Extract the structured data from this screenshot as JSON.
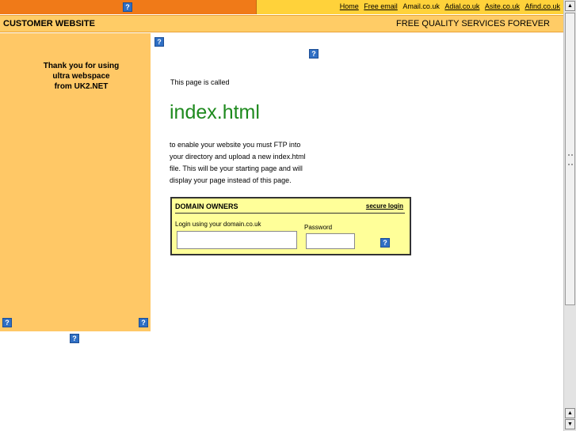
{
  "top_links": [
    "Home",
    "Free email"
  ],
  "top_plain": "Amail.co.uk",
  "top_links2": [
    "Adial.co.uk",
    "Asite.co.uk",
    "Afind.co.uk"
  ],
  "header": {
    "left": "CUSTOMER WEBSITE",
    "right": "FREE QUALITY SERVICES FOREVER"
  },
  "sidebar": {
    "message_lines": [
      "Thank you for using",
      "ultra webspace",
      "from UK2.NET"
    ]
  },
  "main": {
    "called": "This page is called",
    "filename": "index.html",
    "para_lines": [
      "to enable your website you must FTP into",
      "your directory and upload a new index.html",
      "file. This will be your starting page and will",
      "display your page instead of this page."
    ]
  },
  "login": {
    "title": "DOMAIN OWNERS",
    "secure": "secure login",
    "login_label": "Login using your domain.co.uk",
    "password_label": "Password",
    "login_value": "",
    "password_value": ""
  },
  "broken_image_glyph": "?",
  "icons": [
    "broken-image-icon",
    "scroll-up-arrow-icon",
    "scroll-down-arrow-icon"
  ]
}
